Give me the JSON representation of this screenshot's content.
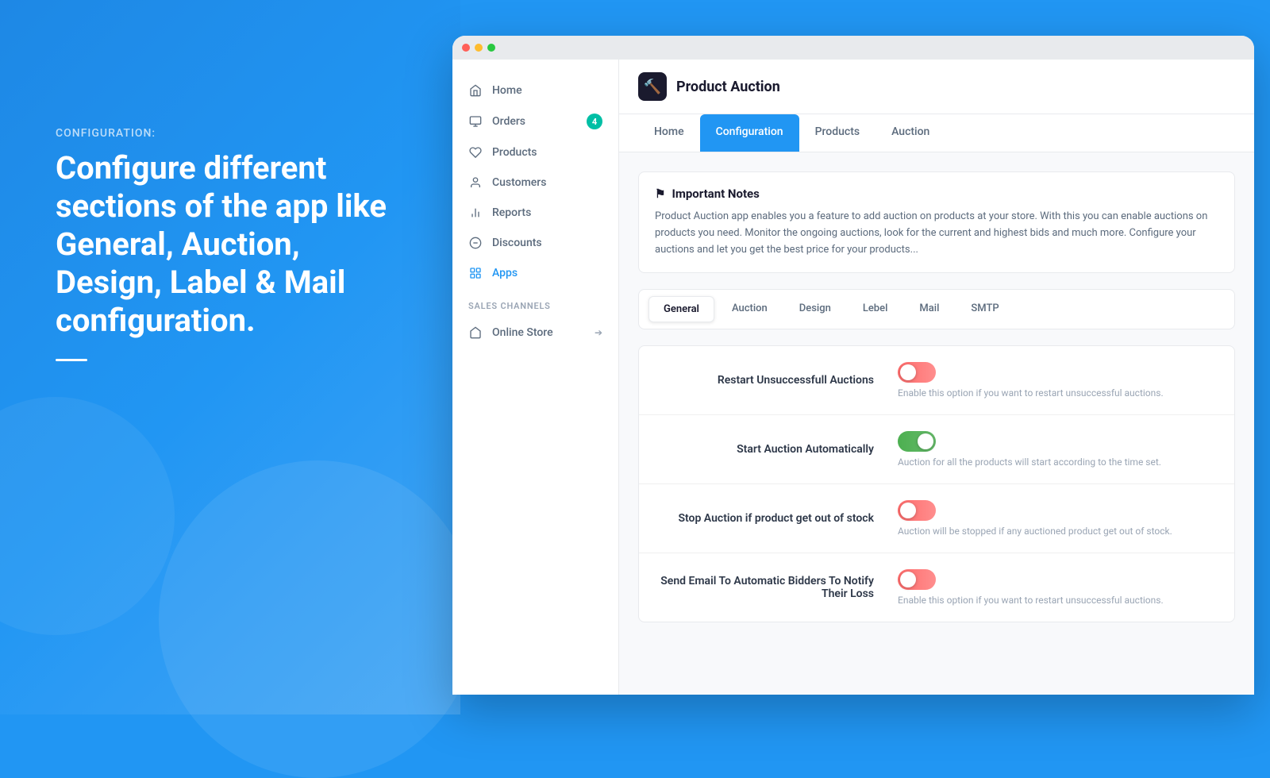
{
  "left": {
    "label": "CONFIGURATION:",
    "title": "Configure different sections of the app like General, Auction, Design, Label & Mail configuration."
  },
  "window": {
    "sidebar": {
      "nav_items": [
        {
          "id": "home",
          "label": "Home",
          "icon": "home-icon",
          "badge": null,
          "active": false
        },
        {
          "id": "orders",
          "label": "Orders",
          "icon": "orders-icon",
          "badge": "4",
          "active": false
        },
        {
          "id": "products",
          "label": "Products",
          "icon": "products-icon",
          "badge": null,
          "active": false
        },
        {
          "id": "customers",
          "label": "Customers",
          "icon": "customers-icon",
          "badge": null,
          "active": false
        },
        {
          "id": "reports",
          "label": "Reports",
          "icon": "reports-icon",
          "badge": null,
          "active": false
        },
        {
          "id": "discounts",
          "label": "Discounts",
          "icon": "discounts-icon",
          "badge": null,
          "active": false
        },
        {
          "id": "apps",
          "label": "Apps",
          "icon": "apps-icon",
          "badge": null,
          "active": true
        }
      ],
      "sales_channels_label": "SALES CHANNELS",
      "sales_channels": [
        {
          "id": "online-store",
          "label": "Online Store",
          "icon": "store-icon",
          "external": true
        }
      ]
    },
    "topbar": {
      "title": "Product Auction",
      "icon": "auction-icon"
    },
    "main_tabs": [
      {
        "id": "home",
        "label": "Home",
        "active": false
      },
      {
        "id": "configuration",
        "label": "Configuration",
        "active": true
      },
      {
        "id": "products",
        "label": "Products",
        "active": false
      },
      {
        "id": "auction",
        "label": "Auction",
        "active": false
      }
    ],
    "notes": {
      "header": "⚑ Important Notes",
      "text": "Product Auction app enables you a feature to add auction on products at your store. With this you can enable auctions on products you need. Monitor the ongoing auctions, look for the current and highest bids and much more. Configure your auctions and let you get the best price for your products..."
    },
    "sub_tabs": [
      {
        "id": "general",
        "label": "General",
        "active": true
      },
      {
        "id": "auction",
        "label": "Auction",
        "active": false
      },
      {
        "id": "design",
        "label": "Design",
        "active": false
      },
      {
        "id": "lebel",
        "label": "Lebel",
        "active": false
      },
      {
        "id": "mail",
        "label": "Mail",
        "active": false
      },
      {
        "id": "smtp",
        "label": "SMTP",
        "active": false
      }
    ],
    "settings": [
      {
        "id": "restart-unsuccessful",
        "label": "Restart Unsuccessfull Auctions",
        "description": "Enable this option if you want to restart unsuccessful auctions.",
        "toggle": "off"
      },
      {
        "id": "start-automatically",
        "label": "Start Auction Automatically",
        "description": "Auction for all the products will start according to the time set.",
        "toggle": "on"
      },
      {
        "id": "stop-out-of-stock",
        "label": "Stop Auction if product get out of stock",
        "description": "Auction will be stopped if any auctioned product get out of stock.",
        "toggle": "off"
      },
      {
        "id": "send-email",
        "label": "Send Email To Automatic Bidders To Notify Their Loss",
        "description": "Enable this option if you want to restart unsuccessful auctions.",
        "toggle": "off"
      }
    ]
  }
}
